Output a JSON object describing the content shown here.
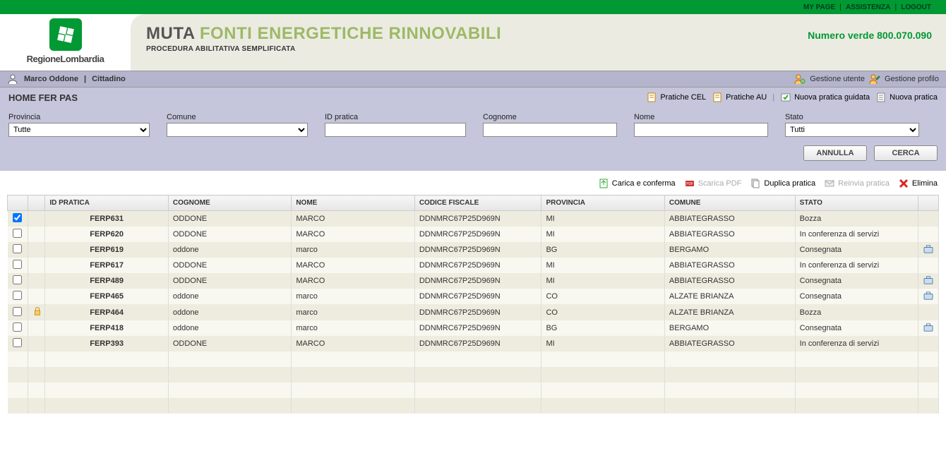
{
  "topbar": {
    "my_page": "MY PAGE",
    "assistenza": "ASSISTENZA",
    "logout": "LOGOUT"
  },
  "logo": {
    "text": "RegioneLombardia"
  },
  "header": {
    "title_strong": "MUTA",
    "title_rest": "FONTI ENERGETICHE RINNOVABILI",
    "subtitle": "PROCEDURA ABILITATIVA SEMPLIFICATA",
    "numero_verde": "Numero verde 800.070.090"
  },
  "userbar": {
    "user": "Marco Oddone",
    "role": "Cittadino",
    "gestione_utente": "Gestione utente",
    "gestione_profilo": "Gestione profilo"
  },
  "actionbar": {
    "title": "HOME FER PAS",
    "pratiche_cel": "Pratiche CEL",
    "pratiche_au": "Pratiche AU",
    "nuova_guidata": "Nuova pratica guidata",
    "nuova_pratica": "Nuova pratica"
  },
  "filters": {
    "provincia_label": "Provincia",
    "provincia_value": "Tutte",
    "comune_label": "Comune",
    "comune_value": "",
    "idpratica_label": "ID pratica",
    "idpratica_value": "",
    "cognome_label": "Cognome",
    "cognome_value": "",
    "nome_label": "Nome",
    "nome_value": "",
    "stato_label": "Stato",
    "stato_value": "Tutti"
  },
  "buttons": {
    "annulla": "ANNULLA",
    "cerca": "CERCA"
  },
  "toolbar": {
    "carica": "Carica e conferma",
    "pdf": "Scarica PDF",
    "duplica": "Duplica pratica",
    "reinvia": "Reinvia pratica",
    "elimina": "Elimina"
  },
  "table": {
    "headers": {
      "id": "ID PRATICA",
      "cognome": "COGNOME",
      "nome": "NOME",
      "cf": "CODICE FISCALE",
      "provincia": "PROVINCIA",
      "comune": "COMUNE",
      "stato": "STATO"
    },
    "rows": [
      {
        "checked": true,
        "locked": false,
        "id": "FERP631",
        "cognome": "ODDONE",
        "nome": "MARCO",
        "cf": "DDNMRC67P25D969N",
        "provincia": "MI",
        "comune": "ABBIATEGRASSO",
        "stato": "Bozza",
        "action": false
      },
      {
        "checked": false,
        "locked": false,
        "id": "FERP620",
        "cognome": "ODDONE",
        "nome": "MARCO",
        "cf": "DDNMRC67P25D969N",
        "provincia": "MI",
        "comune": "ABBIATEGRASSO",
        "stato": "In conferenza di servizi",
        "action": false
      },
      {
        "checked": false,
        "locked": false,
        "id": "FERP619",
        "cognome": "oddone",
        "nome": "marco",
        "cf": "DDNMRC67P25D969N",
        "provincia": "BG",
        "comune": "BERGAMO",
        "stato": "Consegnata",
        "action": true
      },
      {
        "checked": false,
        "locked": false,
        "id": "FERP617",
        "cognome": "ODDONE",
        "nome": "MARCO",
        "cf": "DDNMRC67P25D969N",
        "provincia": "MI",
        "comune": "ABBIATEGRASSO",
        "stato": "In conferenza di servizi",
        "action": false
      },
      {
        "checked": false,
        "locked": false,
        "id": "FERP489",
        "cognome": "ODDONE",
        "nome": "MARCO",
        "cf": "DDNMRC67P25D969N",
        "provincia": "MI",
        "comune": "ABBIATEGRASSO",
        "stato": "Consegnata",
        "action": true
      },
      {
        "checked": false,
        "locked": false,
        "id": "FERP465",
        "cognome": "oddone",
        "nome": "marco",
        "cf": "DDNMRC67P25D969N",
        "provincia": "CO",
        "comune": "ALZATE BRIANZA",
        "stato": "Consegnata",
        "action": true
      },
      {
        "checked": false,
        "locked": true,
        "id": "FERP464",
        "cognome": "oddone",
        "nome": "marco",
        "cf": "DDNMRC67P25D969N",
        "provincia": "CO",
        "comune": "ALZATE BRIANZA",
        "stato": "Bozza",
        "action": false
      },
      {
        "checked": false,
        "locked": false,
        "id": "FERP418",
        "cognome": "oddone",
        "nome": "marco",
        "cf": "DDNMRC67P25D969N",
        "provincia": "BG",
        "comune": "BERGAMO",
        "stato": "Consegnata",
        "action": true
      },
      {
        "checked": false,
        "locked": false,
        "id": "FERP393",
        "cognome": "ODDONE",
        "nome": "MARCO",
        "cf": "DDNMRC67P25D969N",
        "provincia": "MI",
        "comune": "ABBIATEGRASSO",
        "stato": "In conferenza di servizi",
        "action": false
      }
    ]
  }
}
